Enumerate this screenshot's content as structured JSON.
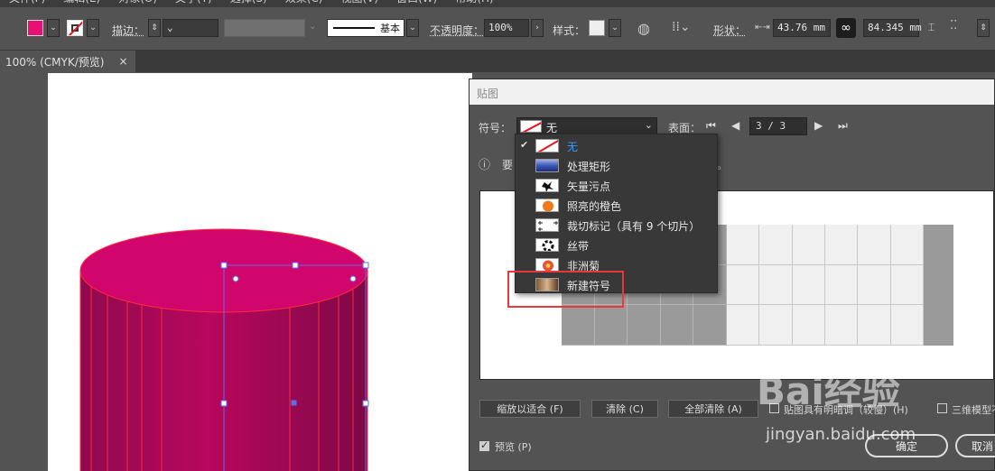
{
  "menubar": {
    "items": [
      "文件(F)",
      "编辑(E)",
      "对象(O)",
      "文字(T)",
      "选择(S)",
      "效果(C)",
      "视图(V)",
      "窗口(W)",
      "帮助(H)"
    ]
  },
  "controlbar": {
    "fill_color": "#ea0f74",
    "stroke_label": "描边：",
    "stroke_style_label": "基本",
    "opacity_label": "不透明度：",
    "opacity_value": "100%",
    "style_label": "样式：",
    "shape_label": "形状：",
    "width_value": "43.76 mm",
    "height_value": "84.345 mm"
  },
  "tab": {
    "title": "100% (CMYK/预览)",
    "close_symbol": "×"
  },
  "dialog": {
    "title": "贴图",
    "symbol_label": "符号：",
    "symbol_value": "无",
    "surface_label": "表面：",
    "page_value": "3 / 3",
    "info_prefix": "要",
    "info_suffix": "。",
    "buttons": {
      "fit": "缩放以适合 (F)",
      "clear": "清除 (C)",
      "clear_all": "全部清除 (A)",
      "shade_artwork": "贴图具有明暗调（较慢）(H)",
      "invisible_geometry": "三维模型不可见",
      "preview": "预览 (P)",
      "ok": "确定",
      "cancel": "取消"
    },
    "preview_checked": true
  },
  "dropdown": {
    "items": [
      {
        "label": "无",
        "selected": true,
        "icon": "none-icon"
      },
      {
        "label": "处理矩形",
        "selected": false,
        "icon": "blue-rect-icon"
      },
      {
        "label": "矢量污点",
        "selected": false,
        "icon": "splat-icon"
      },
      {
        "label": "照亮的橙色",
        "selected": false,
        "icon": "orange-icon"
      },
      {
        "label": "裁切标记（具有 9 个切片）",
        "selected": false,
        "icon": "crop-marks-icon"
      },
      {
        "label": "丝带",
        "selected": false,
        "icon": "ribbon-icon"
      },
      {
        "label": "非洲菊",
        "selected": false,
        "icon": "flower-icon"
      },
      {
        "label": "新建符号",
        "selected": false,
        "icon": "new-symbol-icon"
      }
    ]
  },
  "watermark": {
    "brand": "Bai经验",
    "url": "jingyan.baidu.com"
  },
  "colors": {
    "accent_red": "#e8373d",
    "cylinder": "#b8075e",
    "selection_blue": "#5a6fe8"
  }
}
